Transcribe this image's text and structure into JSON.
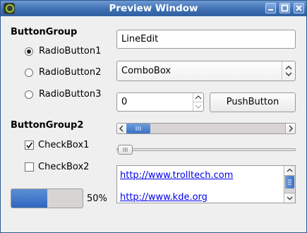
{
  "window": {
    "title": "Preview Window"
  },
  "group1": {
    "title": "ButtonGroup",
    "radios": [
      {
        "label": "RadioButton1",
        "checked": true
      },
      {
        "label": "RadioButton2",
        "checked": false
      },
      {
        "label": "RadioButton3",
        "checked": false
      }
    ]
  },
  "group2": {
    "title": "ButtonGroup2",
    "checks": [
      {
        "label": "CheckBox1",
        "checked": true
      },
      {
        "label": "CheckBox2",
        "checked": false
      }
    ]
  },
  "progress": {
    "value_percent": 50,
    "label": "50%"
  },
  "line_edit": {
    "value": "LineEdit"
  },
  "combo_box": {
    "value": "ComboBox"
  },
  "spin_box": {
    "value": "0"
  },
  "push_button": {
    "label": "PushButton"
  },
  "scrollbar": {
    "position": 0.0
  },
  "slider": {
    "position": 0.0
  },
  "text_browser": {
    "links": [
      "http://www.trolltech.com",
      "http://www.kde.org"
    ]
  },
  "colors": {
    "title_bar": "#3f70b3",
    "accent": "#2f67be",
    "link": "#0000ee"
  }
}
